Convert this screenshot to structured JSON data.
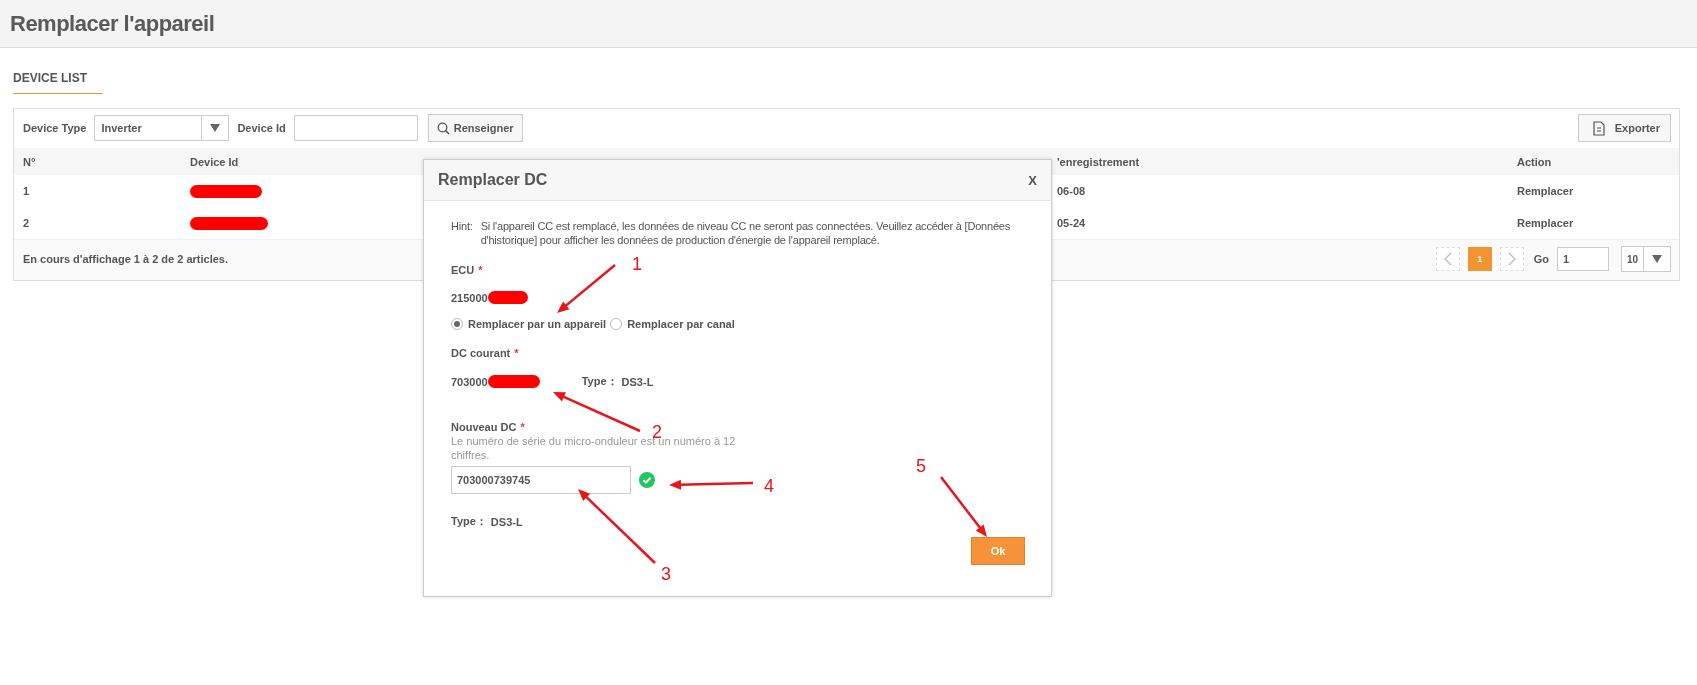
{
  "page": {
    "title": "Remplacer l'appareil"
  },
  "section": {
    "title": "DEVICE LIST"
  },
  "filters": {
    "device_type": {
      "label": "Device Type",
      "value": "Inverter"
    },
    "device_id": {
      "label": "Device Id"
    },
    "search_button": "Renseigner",
    "export_button": "Exporter"
  },
  "table": {
    "columns": [
      {
        "label": "N°"
      },
      {
        "label": "Device Id"
      },
      {
        "label": "'enregistrement"
      },
      {
        "label": "Action"
      }
    ],
    "rows": [
      {
        "no": "1",
        "date": "06-08",
        "action": "Remplacer"
      },
      {
        "no": "2",
        "date": "05-24",
        "action": "Remplacer"
      }
    ],
    "footer": "En cours d'affichage 1 à 2 de 2 articles."
  },
  "pagination": {
    "pages": [
      {
        "label": "1",
        "selected": true
      }
    ],
    "go_label": "Go",
    "go_value": "1",
    "page_size": "10"
  },
  "modal": {
    "title": "Remplacer DC",
    "close": "X",
    "hint_label": "Hint:",
    "hint": "Si l'appareil CC est remplacé, les données de niveau CC ne seront pas connectées. Veuillez accéder à [Données d'historique] pour afficher les données de production d'énergie de l'appareil remplacé.",
    "ecu": {
      "label": "ECU",
      "required": "*",
      "value": "215000"
    },
    "options": [
      {
        "label": "Remplacer par un appareil",
        "selected": true
      },
      {
        "label": "Remplacer par canal",
        "selected": false
      }
    ],
    "current_dc": {
      "label": "DC courant",
      "required": "*",
      "value": "703000",
      "type_label": "Type：",
      "type": "DS3-L"
    },
    "new_dc": {
      "label": "Nouveau DC",
      "required": "*",
      "help": "Le numéro de série du micro-onduleur est un numéro à 12 chiffres.",
      "value": "703000739745",
      "valid": true,
      "type_label": "Type：",
      "type": "DS3-L"
    },
    "ok_button": "Ok"
  },
  "annotations": [
    {
      "label": "1"
    },
    {
      "label": "2"
    },
    {
      "label": "3"
    },
    {
      "label": "4"
    },
    {
      "label": "5"
    }
  ]
}
